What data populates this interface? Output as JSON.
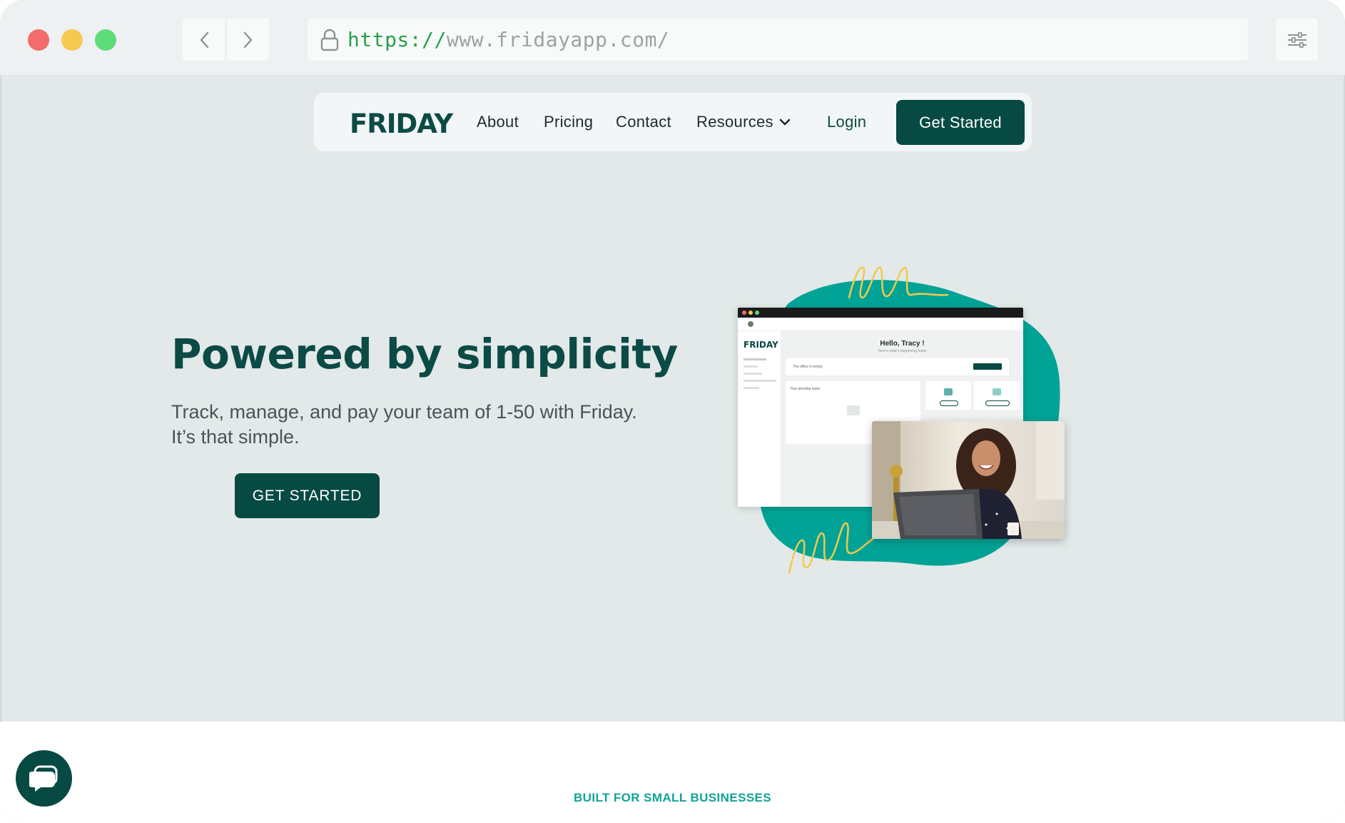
{
  "browser": {
    "url_scheme": "https://",
    "url_rest": "www.fridayapp.com/"
  },
  "nav": {
    "logo": "FRIDAY",
    "about": "About",
    "pricing": "Pricing",
    "contact": "Contact",
    "resources": "Resources",
    "login": "Login",
    "get_started": "Get Started"
  },
  "hero": {
    "title": "Powered by simplicity",
    "subtitle_line1": "Track, manage, and pay your team of 1-50 with Friday.",
    "subtitle_line2": "It’s that simple.",
    "cta": "GET STARTED"
  },
  "app_preview": {
    "logo": "FRIDAY",
    "greeting": "Hello, Tracy !",
    "greeting_sub": "Here's what's happening today",
    "office_status": "The office is empty",
    "pending_tasks": "Your pending tasks"
  },
  "section": {
    "eyebrow": "BUILT FOR SMALL BUSINESSES"
  },
  "colors": {
    "brand_dark": "#064a43",
    "brand_teal": "#00a396",
    "accent_yellow": "#f2c94c",
    "page_bg": "#e2e9e8"
  }
}
